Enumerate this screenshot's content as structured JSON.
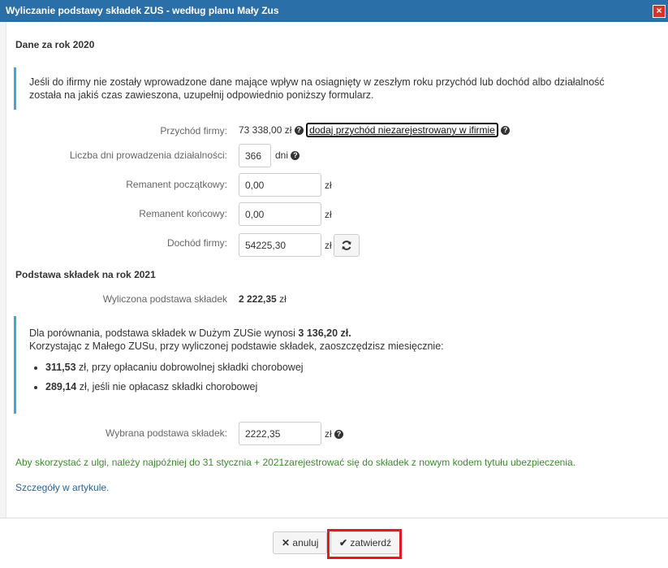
{
  "dialog": {
    "title": "Wyliczanie podstawy składek ZUS - według planu Mały Zus",
    "close_glyph": "×"
  },
  "section1": {
    "title": "Dane za rok 2020",
    "info_line1": "Jeśli do ifirmy nie zostały wprowadzone dane mające wpływ na osiagnięty w zeszłym roku przychód lub dochód albo działalność",
    "info_line2": "została na jakiś czas zawieszona, uzupełnij odpowiednio poniższy formularz."
  },
  "form": {
    "revenue_label": "Przychód firmy:",
    "revenue_value": "73 338,00 zł",
    "revenue_link": "dodaj przychód niezarejestrowany w ifirmie",
    "days_label": "Liczba dni prowadzenia działalności:",
    "days_value": "366",
    "days_unit": "dni",
    "remanent_start_label": "Remanent początkowy:",
    "remanent_start_value": "0,00",
    "remanent_end_label": "Remanent końcowy:",
    "remanent_end_value": "0,00",
    "income_label": "Dochód firmy:",
    "income_value": "54225,30",
    "currency": "zł"
  },
  "section2": {
    "title": "Podstawa składek na rok 2021",
    "calc_label": "Wyliczona podstawa składek",
    "calc_value": "2 222,35",
    "calc_unit": "zł"
  },
  "comparison": {
    "line1_prefix": "Dla porównania, podstawa składek w Dużym ZUSie wynosi ",
    "line1_value": "3 136,20 zł.",
    "line2": "Korzystając z Małego ZUSu, przy wyliczonej podstawie składek, zaoszczędzisz miesięcznie:",
    "items": [
      {
        "amount": "311,53",
        "text": " zł, przy opłacaniu dobrowolnej składki chorobowej"
      },
      {
        "amount": "289,14",
        "text": " zł, jeśli nie opłacasz składki chorobowej"
      }
    ]
  },
  "selected": {
    "label": "Wybrana podstawa składek:",
    "value": "2222,35",
    "unit": "zł"
  },
  "notice": "Aby skorzystać z ulgi, należy najpóźniej do 31 stycznia + 2021zarejestrować się do składek z nowym kodem tytułu ubezpieczenia.",
  "details_link": "Szczegóły w artykule.",
  "footer": {
    "cancel_label": "anuluj",
    "confirm_label": "zatwierdź"
  },
  "colors": {
    "titlebar": "#2b6fa8",
    "accent_border": "#40a8d6",
    "highlight": "#e21b23",
    "notice_green": "#3c8a2e",
    "link": "#2a6496"
  },
  "icons": [
    "close-icon",
    "help-icon",
    "refresh-icon",
    "cancel-x-icon",
    "check-icon"
  ]
}
